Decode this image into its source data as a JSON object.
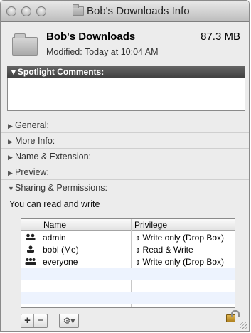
{
  "window": {
    "title": "Bob's Downloads Info"
  },
  "header": {
    "name": "Bob's Downloads",
    "size": "87.3 MB",
    "modified": "Modified: Today at 10:04 AM"
  },
  "spotlight": {
    "label": "Spotlight Comments:",
    "triangle": "▼"
  },
  "sections": {
    "general": "General:",
    "more_info": "More Info:",
    "name_extension": "Name & Extension:",
    "preview": "Preview:",
    "sharing": "Sharing & Permissions:"
  },
  "sharing": {
    "status": "You can read and write",
    "columns": {
      "name": "Name",
      "privilege": "Privilege"
    },
    "rows": [
      {
        "name": "admin",
        "privilege": "Write only (Drop Box)",
        "icon": "group-icon"
      },
      {
        "name": "bobl (Me)",
        "privilege": "Read & Write",
        "icon": "user-icon"
      },
      {
        "name": "everyone",
        "privilege": "Write only (Drop Box)",
        "icon": "everyone-icon"
      }
    ]
  },
  "toolbar": {
    "add": "+",
    "remove": "−",
    "gear": "⚙▾"
  }
}
